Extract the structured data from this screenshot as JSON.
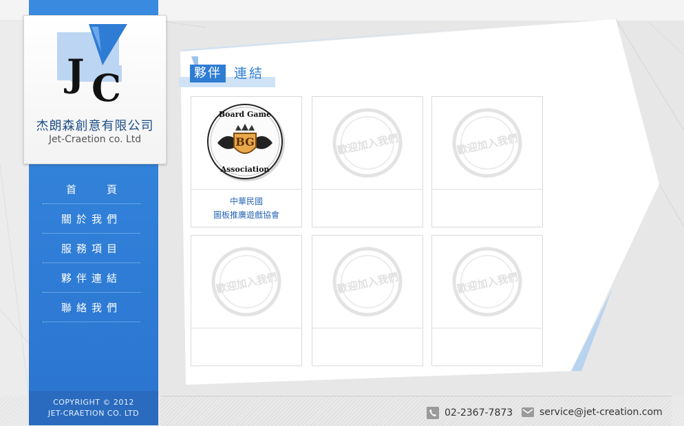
{
  "company": {
    "name_cn": "杰朗森創意有限公司",
    "name_en": "Jet-Craetion co. Ltd",
    "logo_letters": [
      "J",
      "C"
    ]
  },
  "nav": {
    "items": [
      {
        "label": "首頁",
        "icon": "none"
      },
      {
        "label": "關於我們"
      },
      {
        "label": "服務項目"
      },
      {
        "label": "夥伴連結"
      },
      {
        "label": "聯絡我們"
      }
    ]
  },
  "section": {
    "title_highlight": "夥伴",
    "title_rest": "連結"
  },
  "partners": [
    {
      "type": "logo",
      "logo_top": "Board Game",
      "logo_mid": "BG",
      "logo_bottom": "Association",
      "caption_line1": "中華民國",
      "caption_line2": "圖板推廣遊戲協會"
    },
    {
      "type": "placeholder",
      "stamp_text": "歡迎加入我們",
      "caption_line1": "",
      "caption_line2": ""
    },
    {
      "type": "placeholder",
      "stamp_text": "歡迎加入我們",
      "caption_line1": "",
      "caption_line2": ""
    },
    {
      "type": "placeholder",
      "stamp_text": "歡迎加入我們",
      "caption_line1": "",
      "caption_line2": ""
    },
    {
      "type": "placeholder",
      "stamp_text": "歡迎加入我們",
      "caption_line1": "",
      "caption_line2": ""
    },
    {
      "type": "placeholder",
      "stamp_text": "歡迎加入我們",
      "caption_line1": "",
      "caption_line2": ""
    }
  ],
  "copyright": {
    "line1": "COPYRIGHT © 2012",
    "line2": "JET-CRAETION CO. LTD"
  },
  "contact": {
    "phone": "02-2367-7873",
    "phone_icon": "phone-icon",
    "email": "service@jet-creation.com",
    "email_icon": "mail-icon"
  },
  "colors": {
    "accent": "#2e7cd4",
    "sidebar": "#3a8be0",
    "caption": "#2a66b5"
  }
}
